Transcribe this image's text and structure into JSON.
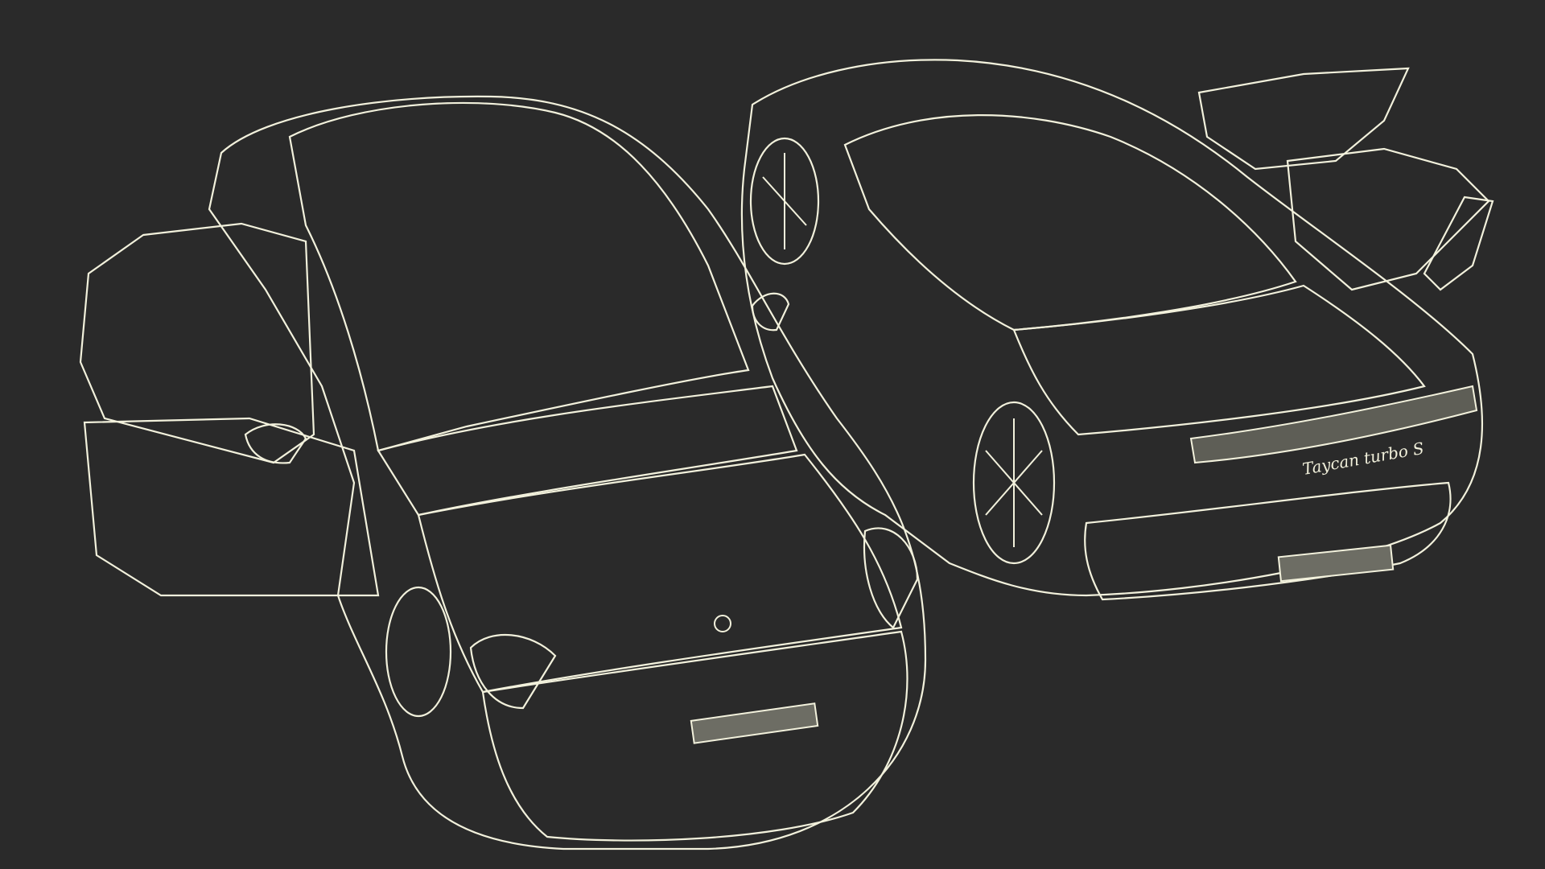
{
  "scene": {
    "description_visible_text": "",
    "background_color": "#2a2a2a",
    "mesh_color": "#e9e8cf",
    "surface_color": "#6f6f66"
  },
  "objects": [
    {
      "id": "car-front",
      "label": "",
      "view": "front-three-quarter",
      "doors": "open"
    },
    {
      "id": "car-rear",
      "label": "",
      "view": "rear-three-quarter",
      "doors": "open"
    }
  ],
  "markings": {
    "rear_badge_script": "Taycan turbo S"
  }
}
